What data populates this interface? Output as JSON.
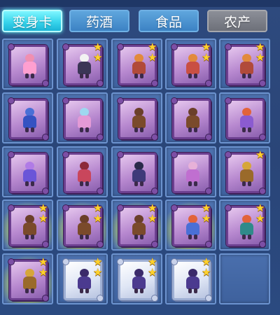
{
  "header": {
    "fragment": ""
  },
  "tabs": [
    {
      "label": "变身卡",
      "active": true
    },
    {
      "label": "药酒",
      "active": false
    },
    {
      "label": "食品",
      "active": false
    },
    {
      "label": "农产",
      "active": false
    }
  ],
  "colors": {
    "active_tab": "#38d5ec",
    "tab": "#3c82c4",
    "disabled_tab": "#6d7079",
    "slot_bg": "#4d72b0",
    "star": "#ffd22c"
  },
  "grid": [
    {
      "stars": 0,
      "icon": "transformation-card-pink-fairy-icon",
      "card": "purple",
      "glow": false,
      "head": "#f08fb1",
      "body": "#ff9fd0"
    },
    {
      "stars": 2,
      "icon": "transformation-card-white-hair-swordsman-icon",
      "card": "purple",
      "glow": false,
      "head": "#f2f2f2",
      "body": "#3b3556"
    },
    {
      "stars": 2,
      "icon": "transformation-card-fox-warrior-icon",
      "card": "purple",
      "glow": false,
      "head": "#e28a3c",
      "body": "#b14a3a"
    },
    {
      "stars": 2,
      "icon": "transformation-card-fox-warrior-icon",
      "card": "purple",
      "glow": false,
      "head": "#e28a3c",
      "body": "#c94f43"
    },
    {
      "stars": 2,
      "icon": "transformation-card-fox-warrior-icon",
      "card": "purple",
      "glow": false,
      "head": "#e28a3c",
      "body": "#b14a3a"
    },
    {
      "stars": 0,
      "icon": "transformation-card-blue-dragon-icon",
      "card": "purple",
      "glow": false,
      "head": "#4a6fd6",
      "body": "#3552c2"
    },
    {
      "stars": 0,
      "icon": "transformation-card-fairy-dragon-icon",
      "card": "purple",
      "glow": false,
      "head": "#9fd7f0",
      "body": "#e39ad6"
    },
    {
      "stars": 0,
      "icon": "transformation-card-cowboy-rider-icon",
      "card": "purple",
      "glow": false,
      "head": "#6b3f2a",
      "body": "#7a4a2b"
    },
    {
      "stars": 0,
      "icon": "transformation-card-cowboy-rider-icon",
      "card": "purple",
      "glow": false,
      "head": "#6b3f2a",
      "body": "#7a4a2b"
    },
    {
      "stars": 0,
      "icon": "transformation-card-red-phoenix-icon",
      "card": "purple",
      "glow": false,
      "head": "#e2633a",
      "body": "#8b5bd0"
    },
    {
      "stars": 0,
      "icon": "transformation-card-purple-cat-icon",
      "card": "purple",
      "glow": false,
      "head": "#b07be6",
      "body": "#6a55d8"
    },
    {
      "stars": 0,
      "icon": "transformation-card-red-bat-icon",
      "card": "purple",
      "glow": false,
      "head": "#8c2a3b",
      "body": "#c9465c"
    },
    {
      "stars": 0,
      "icon": "transformation-card-dark-mage-icon",
      "card": "purple",
      "glow": false,
      "head": "#2a2a4a",
      "body": "#3f3a7a"
    },
    {
      "stars": 0,
      "icon": "transformation-card-pink-dancer-icon",
      "card": "purple",
      "glow": false,
      "head": "#e7b1d8",
      "body": "#c06fd0"
    },
    {
      "stars": 1,
      "icon": "transformation-card-golden-warrior-icon",
      "card": "purple",
      "glow": false,
      "head": "#d6a63a",
      "body": "#9a6a2a"
    },
    {
      "stars": 2,
      "icon": "transformation-card-cowboy-rider-icon",
      "card": "purple",
      "glow": true,
      "head": "#6b3f2a",
      "body": "#7a4a2b"
    },
    {
      "stars": 2,
      "icon": "transformation-card-cowboy-rider-icon",
      "card": "purple",
      "glow": true,
      "head": "#6b3f2a",
      "body": "#7a4a2b"
    },
    {
      "stars": 2,
      "icon": "transformation-card-cowboy-rider-icon",
      "card": "purple",
      "glow": true,
      "head": "#6b3f2a",
      "body": "#7a4a2b"
    },
    {
      "stars": 2,
      "icon": "transformation-card-red-phoenix-icon",
      "card": "purple",
      "glow": true,
      "head": "#e2633a",
      "body": "#4a6fd6"
    },
    {
      "stars": 2,
      "icon": "transformation-card-red-phoenix-icon",
      "card": "purple",
      "glow": false,
      "head": "#e2633a",
      "body": "#2f8a8a"
    },
    {
      "stars": 2,
      "icon": "transformation-card-golden-warrior-icon",
      "card": "purple",
      "glow": true,
      "head": "#d6a63a",
      "body": "#9a6a2a"
    },
    {
      "stars": 2,
      "icon": "transformation-card-purple-knight-icon",
      "card": "silver",
      "glow": false,
      "head": "#3a2a6a",
      "body": "#4b3a8f"
    },
    {
      "stars": 2,
      "icon": "transformation-card-purple-knight-icon",
      "card": "silver",
      "glow": false,
      "head": "#3a2a6a",
      "body": "#4b3a8f"
    },
    {
      "stars": 2,
      "icon": "transformation-card-purple-knight-icon",
      "card": "silver",
      "glow": false,
      "head": "#3a2a6a",
      "body": "#4b3a8f"
    },
    {
      "stars": 0,
      "icon": "empty-slot",
      "card": "none",
      "glow": false,
      "head": "",
      "body": ""
    }
  ]
}
